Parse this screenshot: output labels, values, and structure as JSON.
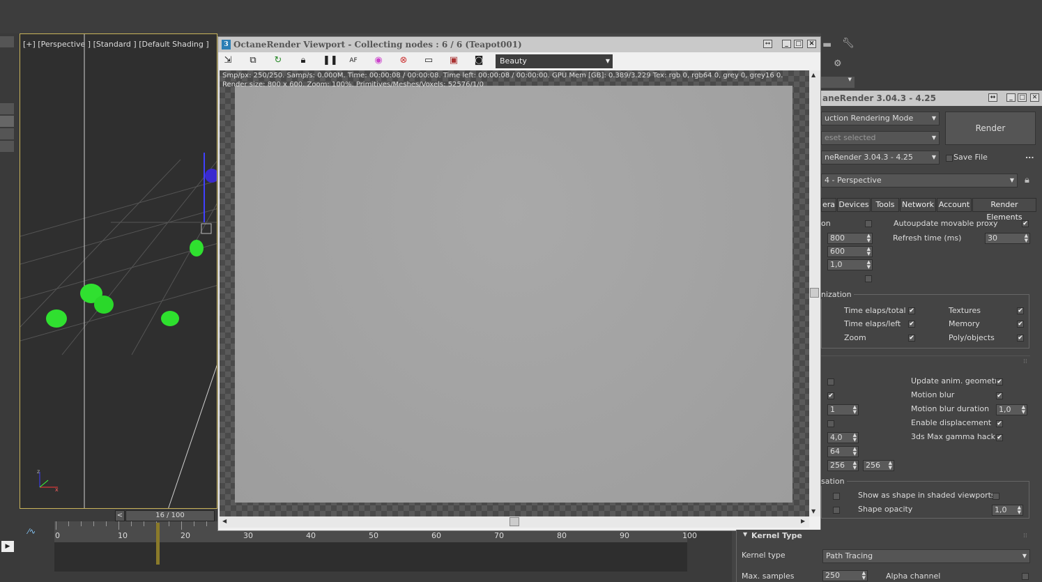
{
  "viewport": {
    "label": "[+] [Perspective ] [Standard ] [Default Shading ]"
  },
  "timeline": {
    "frame": "16 / 100",
    "prev_label": "<",
    "marks": [
      "0",
      "10",
      "20",
      "30",
      "40",
      "50",
      "60",
      "70",
      "80",
      "90",
      "100"
    ]
  },
  "octane": {
    "title": "OctaneRender Viewport - Collecting nodes : 6 / 6 (Teapot001)",
    "title_icon": "3",
    "pass": "Beauty",
    "toolbar_icons": [
      "save-icon",
      "copy-icon",
      "refresh-icon",
      "lock-icon",
      "pause-icon",
      "af-icon",
      "color-icon",
      "clay-icon",
      "monitor-icon",
      "region-icon",
      "camera-icon"
    ],
    "info_line1": "Smp/px: 250/250.   Samp/s: 0.000M.   Time: 00:00:08 / 00:00:08.   Time left: 00:00:08 / 00:00:00.   GPU Mem [GB]: 0.389/3.229   Tex: rgb 0, rgb64 0, grey 0, grey16 0.",
    "info_line2": "Render size: 800 x 600.   Zoom: 100%.   Primitives/Meshes/Voxels: 52576/1/0"
  },
  "panel": {
    "title": "aneRender 3.04.3 - 4.25",
    "mode": "uction Rendering Mode",
    "preset": "eset selected",
    "renderer": "neRender 3.04.3 - 4.25",
    "render_button": "Render",
    "save_file": "Save File",
    "more": "...",
    "camera": "4 - Perspective",
    "tabs": [
      "era",
      "Devices",
      "Tools",
      "Network",
      "Account",
      "Render Elements"
    ],
    "section1": {
      "cut_label": "on",
      "autoupdate": "Autoupdate movable proxy",
      "refresh_label": "Refresh time (ms)",
      "refresh_value": "30",
      "width": "800",
      "height": "600",
      "ratio": "1,0"
    },
    "section2": {
      "title": "nization",
      "items": [
        {
          "label": "Time elaps/total",
          "checked": "✔"
        },
        {
          "label": "Textures",
          "checked": "✔"
        },
        {
          "label": "Time elaps/left",
          "checked": "✔"
        },
        {
          "label": "Memory",
          "checked": "✔"
        },
        {
          "label": "Zoom",
          "checked": "✔"
        },
        {
          "label": "Poly/objects",
          "checked": "✔"
        }
      ]
    },
    "section3": {
      "update_anim": "Update anim. geometry",
      "motion_blur": "Motion blur",
      "motion_blur_duration": "Motion blur duration",
      "motion_blur_value": "1,0",
      "enable_disp": "Enable displacement",
      "gamma_hack": "3ds Max gamma hack",
      "v1": "1",
      "v2": "4,0",
      "v3": "64",
      "v4": "256",
      "v5": "256"
    },
    "section4": {
      "title": "sation",
      "show_shape": "Show as shape in shaded viewports",
      "shape_opacity": "Shape opacity",
      "opacity_value": "1,0"
    },
    "kernel": {
      "title": "Kernel Type",
      "type_label": "Kernel type",
      "type_value": "Path Tracing",
      "max_samples_label": "Max. samples",
      "max_samples_value": "250",
      "alpha_label": "Alpha channel"
    }
  }
}
